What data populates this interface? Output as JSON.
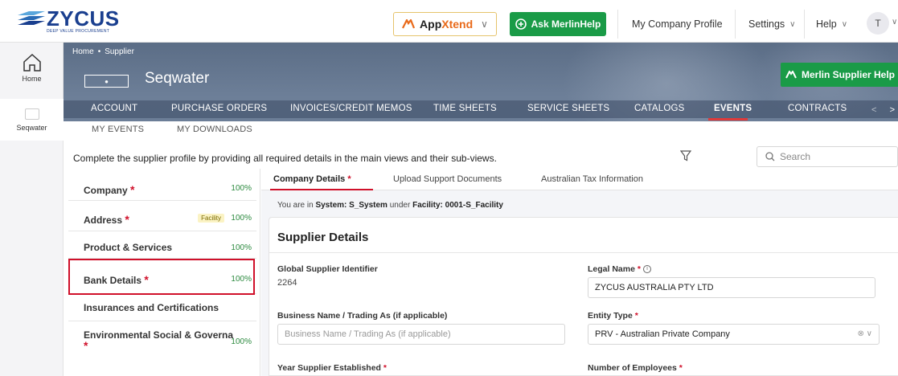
{
  "brand": {
    "logo_text": "ZYCUS",
    "logo_tagline": "DEEP VALUE PROCUREMENT"
  },
  "topbar": {
    "appxtend_a": "App",
    "appxtend_b": "Xtend",
    "ask_merlin": "Ask MerlinHelp",
    "company_profile": "My Company Profile",
    "settings": "Settings",
    "help": "Help",
    "avatar_initial": "T"
  },
  "rail": {
    "home_label": "Home",
    "supplier_label": "Seqwater"
  },
  "banner": {
    "breadcrumb_home": "Home",
    "breadcrumb_supplier": "Supplier",
    "supplier_name": "Seqwater",
    "merlin_supplier_help": "Merlin Supplier Help"
  },
  "nav": {
    "items": [
      "ACCOUNT",
      "PURCHASE ORDERS",
      "INVOICES/CREDIT MEMOS",
      "TIME SHEETS",
      "SERVICE SHEETS",
      "CATALOGS",
      "EVENTS",
      "CONTRACTS"
    ],
    "active": "EVENTS"
  },
  "subnav": {
    "items": [
      "MY EVENTS",
      "MY DOWNLOADS"
    ]
  },
  "info": {
    "message": "Complete the supplier profile by providing all required details in the main views and their sub-views.",
    "search_placeholder": "Search"
  },
  "sections": [
    {
      "name": "Company",
      "required": true,
      "badge": "",
      "pct": "100%"
    },
    {
      "name": "Address",
      "required": true,
      "badge": "Facility",
      "pct": "100%"
    },
    {
      "name": "Product & Services",
      "required": false,
      "badge": "",
      "pct": "100%"
    },
    {
      "name": "Bank Details",
      "required": true,
      "badge": "",
      "pct": "100%"
    },
    {
      "name": "Insurances and Certifications",
      "required": false,
      "badge": "",
      "pct": ""
    },
    {
      "name": "Environmental Social & Governa",
      "required": true,
      "badge": "",
      "pct": "100%"
    }
  ],
  "tabs": {
    "items": [
      "Company Details",
      "Upload Support Documents",
      "Australian Tax Information"
    ]
  },
  "context": {
    "prefix": "You are in",
    "system_label": "System: S_System",
    "under": "under",
    "facility_label": "Facility: 0001-S_Facility"
  },
  "form": {
    "title": "Supplier Details",
    "global_id_label": "Global Supplier Identifier",
    "global_id_value": "2264",
    "legal_name_label": "Legal Name",
    "legal_name_value": "ZYCUS AUSTRALIA PTY LTD",
    "business_name_label": "Business Name / Trading As (if applicable)",
    "business_name_placeholder": "Business Name / Trading As (if applicable)",
    "entity_type_label": "Entity Type",
    "entity_type_value": "PRV - Australian Private Company",
    "year_established_label": "Year Supplier Established",
    "employees_label": "Number of Employees",
    "required_mark": "*"
  }
}
